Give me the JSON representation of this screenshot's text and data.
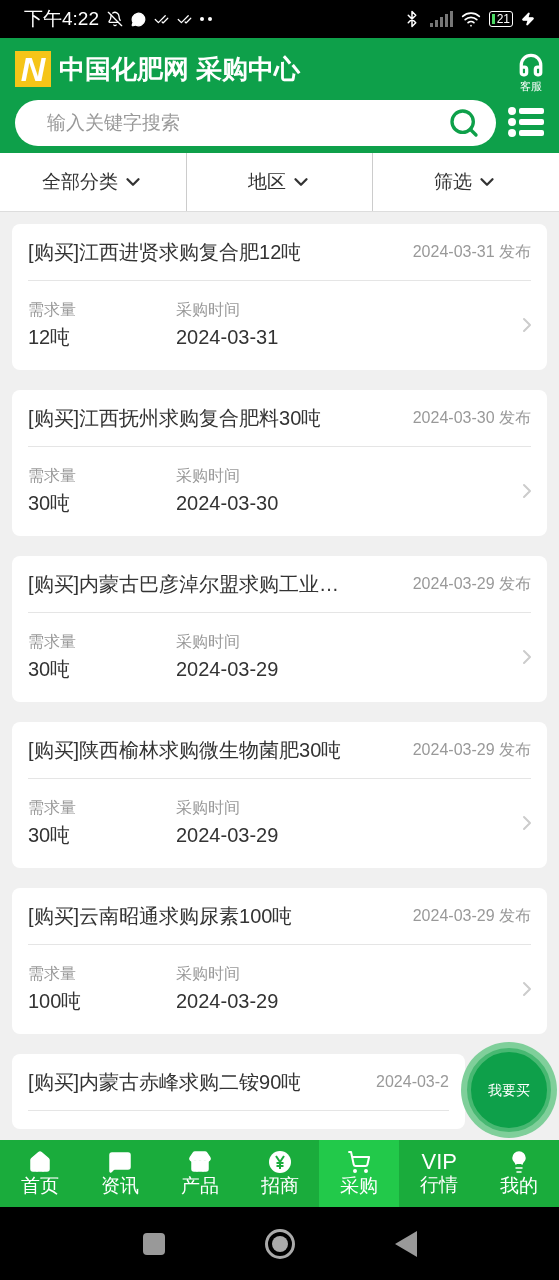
{
  "status_bar": {
    "time": "下午4:22",
    "battery": "21"
  },
  "header": {
    "logo_letter": "N",
    "title": "中国化肥网 采购中心",
    "service_label": "客服"
  },
  "search": {
    "placeholder": "输入关键字搜索"
  },
  "filters": [
    {
      "label": "全部分类"
    },
    {
      "label": "地区"
    },
    {
      "label": "筛选"
    }
  ],
  "listings": [
    {
      "title": "[购买]江西进贤求购复合肥12吨",
      "published": "2024-03-31 发布",
      "quantity_label": "需求量",
      "quantity": "12吨",
      "time_label": "采购时间",
      "time": "2024-03-31"
    },
    {
      "title": "[购买]江西抚州求购复合肥料30吨",
      "published": "2024-03-30 发布",
      "quantity_label": "需求量",
      "quantity": "30吨",
      "time_label": "采购时间",
      "time": "2024-03-30"
    },
    {
      "title": "[购买]内蒙古巴彦淖尔盟求购工业…",
      "published": "2024-03-29 发布",
      "quantity_label": "需求量",
      "quantity": "30吨",
      "time_label": "采购时间",
      "time": "2024-03-29"
    },
    {
      "title": "[购买]陕西榆林求购微生物菌肥30吨",
      "published": "2024-03-29 发布",
      "quantity_label": "需求量",
      "quantity": "30吨",
      "time_label": "采购时间",
      "time": "2024-03-29"
    },
    {
      "title": "[购买]云南昭通求购尿素100吨",
      "published": "2024-03-29 发布",
      "quantity_label": "需求量",
      "quantity": "100吨",
      "time_label": "采购时间",
      "time": "2024-03-29"
    },
    {
      "title": "[购买]内蒙古赤峰求购二铵90吨",
      "published": "2024-03-2"
    }
  ],
  "fab": {
    "label": "我要买"
  },
  "nav": [
    {
      "label": "首页",
      "selected": false
    },
    {
      "label": "资讯",
      "selected": false
    },
    {
      "label": "产品",
      "selected": false
    },
    {
      "label": "招商",
      "selected": false
    },
    {
      "label": "采购",
      "selected": true
    },
    {
      "label": "行情",
      "icon_text": "VIP",
      "selected": false
    },
    {
      "label": "我的",
      "selected": false
    }
  ]
}
